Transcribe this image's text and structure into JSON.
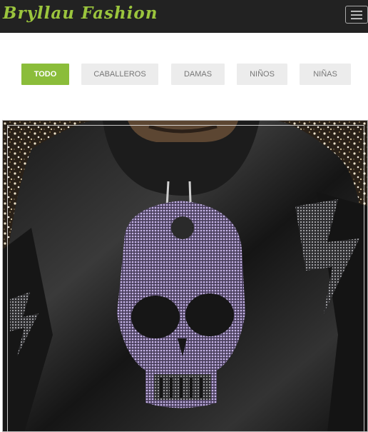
{
  "brand": {
    "title": "Bryllau Fashion",
    "color": "#9bc53d"
  },
  "navbar": {
    "background": "#222222",
    "menu_icon": "hamburger-icon"
  },
  "filters": {
    "active_color": "#8bbd3a",
    "items": [
      {
        "label": "TODO",
        "active": true
      },
      {
        "label": "CABALLEROS",
        "active": false
      },
      {
        "label": "DAMAS",
        "active": false
      },
      {
        "label": "NIÑOS",
        "active": false
      },
      {
        "label": "NIÑAS",
        "active": false
      }
    ]
  },
  "gallery": {
    "image_description": "black velvet hoodie with rhinestone skull",
    "accent_color": "#b6a2dc"
  }
}
